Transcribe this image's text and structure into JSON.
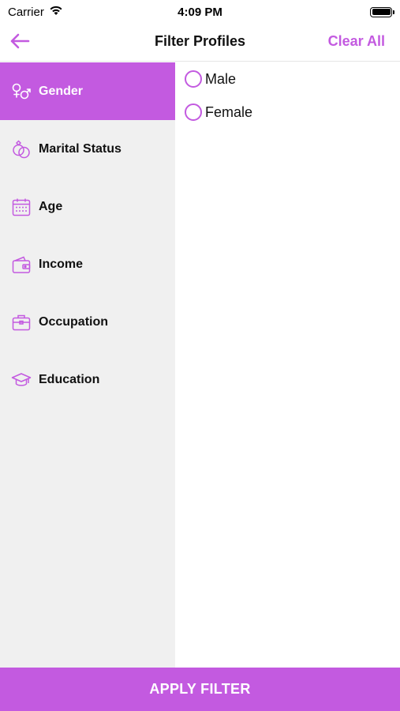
{
  "status_bar": {
    "carrier": "Carrier",
    "time": "4:09 PM"
  },
  "nav": {
    "title": "Filter Profiles",
    "clear_label": "Clear All",
    "back_icon": "arrow-left-icon"
  },
  "sidebar": {
    "items": [
      {
        "label": "Gender",
        "icon": "gender-icon",
        "active": true
      },
      {
        "label": "Marital Status",
        "icon": "rings-icon",
        "active": false
      },
      {
        "label": "Age",
        "icon": "calendar-icon",
        "active": false
      },
      {
        "label": "Income",
        "icon": "wallet-icon",
        "active": false
      },
      {
        "label": "Occupation",
        "icon": "briefcase-icon",
        "active": false
      },
      {
        "label": "Education",
        "icon": "graduation-cap-icon",
        "active": false
      }
    ]
  },
  "options": [
    {
      "label": "Male",
      "selected": false
    },
    {
      "label": "Female",
      "selected": false
    }
  ],
  "apply_label": "APPLY FILTER",
  "colors": {
    "accent": "#c35ae0",
    "sidebar_bg": "#f0f0f0"
  }
}
